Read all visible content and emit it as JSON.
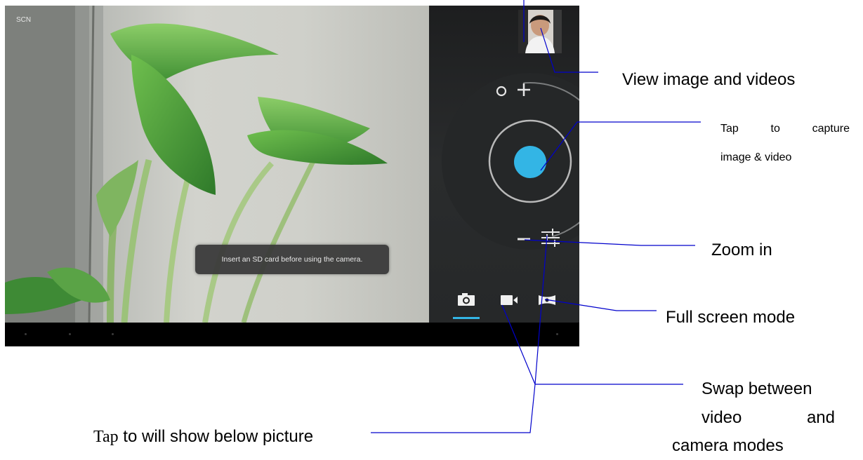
{
  "camera": {
    "scene_mode_label": "SCN",
    "toast_message": "Insert an SD card before using the camera.",
    "accent_color": "#33b5e5",
    "active_mode": "camera",
    "modes": [
      "camera-icon",
      "video-camera-icon",
      "panorama-icon"
    ]
  },
  "annotations": {
    "view_images": "View image and videos",
    "capture_line1": "Tap to capture",
    "capture_line2": "image & video",
    "zoom": "Zoom in",
    "fullscreen": "Full screen mode",
    "swap_line1": "Swap between",
    "swap_line2a": "video",
    "swap_line2b": "and",
    "swap_line3": "camera modes",
    "tap_prefix": "Tap",
    "tap_rest": " to will show below picture",
    "line_color": "#0000cc"
  }
}
